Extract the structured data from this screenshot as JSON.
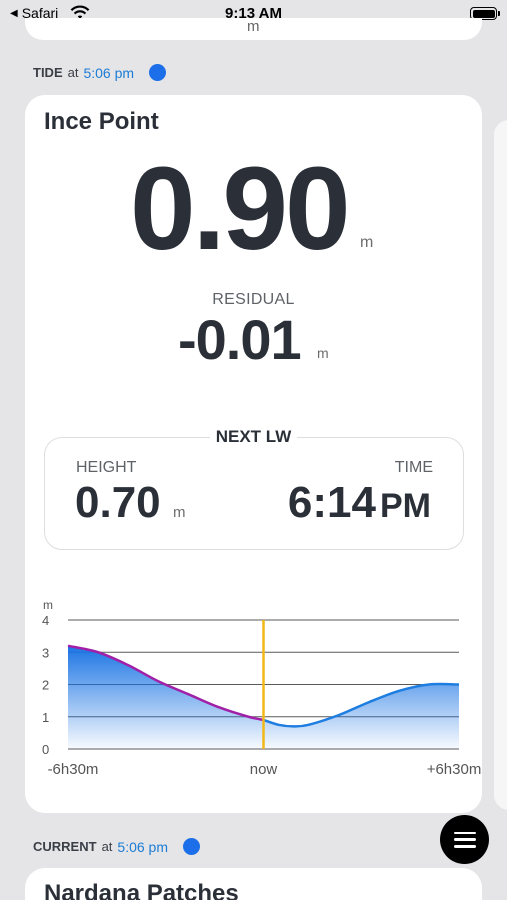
{
  "status_bar": {
    "back_app": "Safari",
    "time": "9:13 AM"
  },
  "top_card": {
    "unit": "m"
  },
  "tide_section": {
    "label": "TIDE",
    "at": "at",
    "time": "5:06 pm"
  },
  "tide": {
    "station": "Ince Point",
    "height": "0.90",
    "height_unit": "m",
    "residual_label": "RESIDUAL",
    "residual": "-0.01",
    "residual_unit": "m"
  },
  "next_lw": {
    "title": "NEXT LW",
    "height_label": "HEIGHT",
    "height": "0.70",
    "height_unit": "m",
    "time_label": "TIME",
    "time": "6:14",
    "ampm": "PM"
  },
  "chart_data": {
    "type": "area",
    "ylabel": "m",
    "ylim": [
      0,
      4
    ],
    "yticks": [
      "0",
      "1",
      "2",
      "3",
      "4"
    ],
    "xticks": [
      "-6h30m",
      "now",
      "+6h30m"
    ],
    "xlim": [
      -6.5,
      6.5
    ],
    "series": [
      {
        "x": [
          -6.5,
          -5.5,
          -4.5,
          -3.5,
          -2.5,
          -1.5,
          -0.5,
          0,
          0.5,
          1.0,
          1.5,
          2.5,
          3.5,
          4.5,
          5.5,
          6.5
        ],
        "y": [
          3.2,
          3.0,
          2.6,
          2.1,
          1.7,
          1.3,
          1.0,
          0.9,
          0.75,
          0.7,
          0.75,
          1.05,
          1.45,
          1.8,
          2.0,
          2.0
        ]
      }
    ],
    "past_color": "#a020a8",
    "future_color": "#1e7de0",
    "now_color": "#f2b81a"
  },
  "current_section": {
    "label": "CURRENT",
    "at": "at",
    "time": "5:06 pm"
  },
  "bottom_card": {
    "station": "Nardana Patches"
  },
  "icons": {
    "fab": "menu-icon"
  }
}
